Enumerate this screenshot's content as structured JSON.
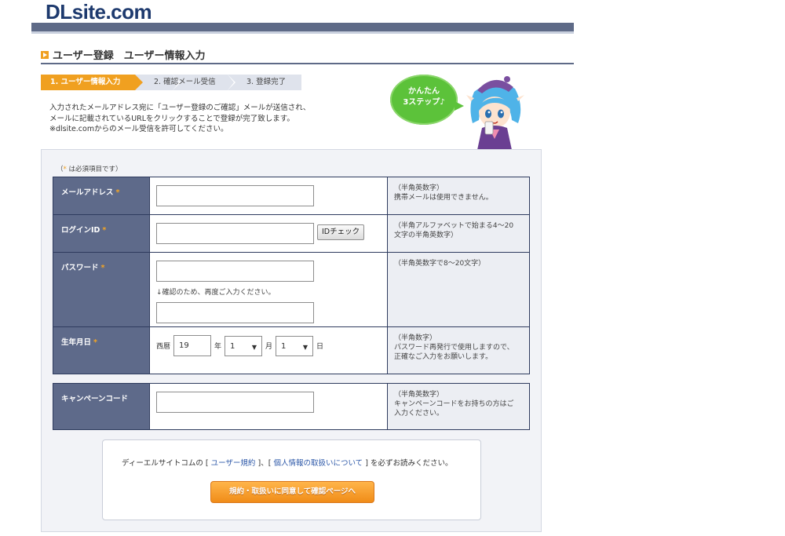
{
  "site": {
    "logo": "DLsite.com"
  },
  "page": {
    "title": "ユーザー登録　ユーザー情報入力"
  },
  "steps": [
    {
      "label": "1. ユーザー情報入力"
    },
    {
      "label": "2. 確認メール受信"
    },
    {
      "label": "3. 登録完了"
    }
  ],
  "intro": {
    "line1": "入力されたメールアドレス宛に「ユーザー登録のご確認」メールが送信され、",
    "line2": "メールに記載されているURLをクリックすることで登録が完了致します。",
    "line3": "※dlsite.comからのメール受信を許可してください。"
  },
  "bubble": {
    "line1": "かんたん",
    "line2": "3ステップ♪"
  },
  "form": {
    "required_note_open": "（",
    "required_star": "*",
    "required_note_close": " は必須項目です）",
    "email": {
      "label": "メールアドレス",
      "star": "*",
      "value": "",
      "hint1": "（半角英数字）",
      "hint2": "携帯メールは使用できません。"
    },
    "login_id": {
      "label": "ログインID",
      "star": "*",
      "value": "",
      "button": "IDチェック",
      "hint1": "（半角アルファベットで始まる4～20",
      "hint2": "文字の半角英数字）"
    },
    "password": {
      "label": "パスワード",
      "star": "*",
      "value": "",
      "confirm_note": "↓確認のため、再度ご入力ください。",
      "confirm_value": "",
      "hint1": "（半角英数字で8～20文字）"
    },
    "birthdate": {
      "label": "生年月日",
      "star": "*",
      "era_label": "西暦",
      "year_value": "19",
      "year_unit": "年",
      "month_value": "1",
      "month_unit": "月",
      "day_value": "1",
      "day_unit": "日",
      "hint1": "（半角数字）",
      "hint2": "パスワード再発行で使用しますので、",
      "hint3": "正確なご入力をお願いします。"
    },
    "campaign": {
      "label": "キャンペーンコード",
      "value": "",
      "hint1": "（半角英数字）",
      "hint2": "キャンペーンコードをお持ちの方はご",
      "hint3": "入力ください。"
    }
  },
  "agreement": {
    "prefix": "ディーエルサイトコムの",
    "bracket_open": "[",
    "terms_link": "ユーザー規約",
    "bracket_close": "]",
    "middle": "、",
    "privacy_link": "個人情報の取扱いについて",
    "suffix": "を必ずお読みください。",
    "submit": "規約・取扱いに同意して確認ページへ"
  },
  "colors": {
    "accent": "#f0a020",
    "header_bar": "#5e6a87",
    "label_bg": "#5e6a8a",
    "bubble": "#5cc23a",
    "link": "#2d58a8"
  }
}
